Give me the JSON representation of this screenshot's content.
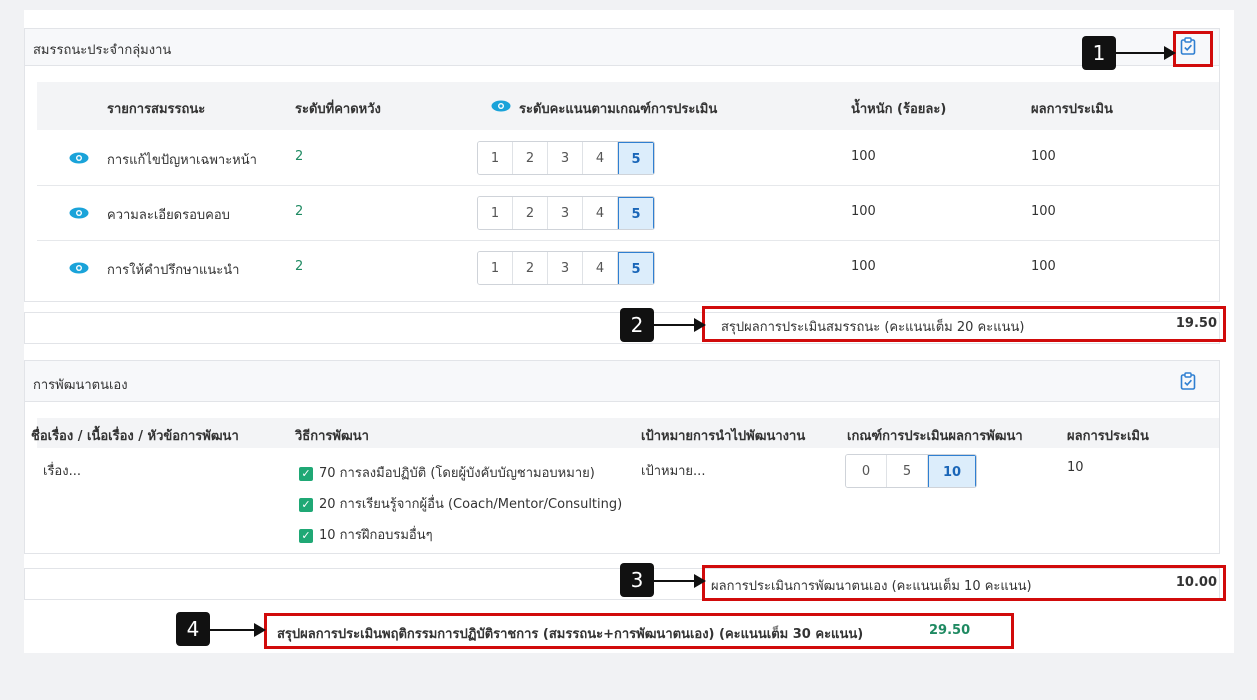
{
  "competency": {
    "title": "สมรรถนะประจำกลุ่มงาน",
    "headers": [
      "รายการสมรรถนะ",
      "ระดับที่คาดหวัง",
      "ระดับคะแนนตามเกณฑ์การประเมิน",
      "น้ำหนัก (ร้อยละ)",
      "ผลการประเมิน"
    ],
    "scale_options": [
      "1",
      "2",
      "3",
      "4",
      "5"
    ],
    "rows": [
      {
        "name": "การแก้ไขปัญหาเฉพาะหน้า",
        "expected": "2",
        "selected": "5",
        "weight": "100",
        "result": "100"
      },
      {
        "name": "ความละเอียดรอบคอบ",
        "expected": "2",
        "selected": "5",
        "weight": "100",
        "result": "100"
      },
      {
        "name": "การให้คำปรึกษาแนะนำ",
        "expected": "2",
        "selected": "5",
        "weight": "100",
        "result": "100"
      }
    ],
    "summary_label": "สรุปผลการประเมินสมรรถนะ (คะแนนเต็ม 20 คะแนน)",
    "summary_value": "19.50"
  },
  "self_dev": {
    "title": "การพัฒนาตนเอง",
    "headers": [
      "ชื่อเรื่อง / เนื้อเรื่อง / หัวข้อการพัฒนา",
      "วิธีการพัฒนา",
      "เป้าหมายการนำไปพัฒนางาน",
      "เกณฑ์การประเมินผลการพัฒนา",
      "ผลการประเมิน"
    ],
    "topic": "เรื่อง...",
    "methods": [
      "70 การลงมือปฏิบัติ (โดยผู้บังคับบัญชามอบหมาย)",
      "20 การเรียนรู้จากผู้อื่น (Coach/Mentor/Consulting)",
      "10 การฝึกอบรมอื่นๆ"
    ],
    "goal": "เป้าหมาย...",
    "criteria_options": [
      "0",
      "5",
      "10"
    ],
    "criteria_selected": "10",
    "result": "10",
    "summary_label": "ผลการประเมินการพัฒนาตนเอง (คะแนนเต็ม 10 คะแนน)",
    "summary_value": "10.00"
  },
  "total": {
    "label": "สรุปผลการประเมินพฤติกรรมการปฏิบัติราชการ (สมรรถนะ+การพัฒนาตนเอง) (คะแนนเต็ม 30 คะแนน)",
    "value": "29.50"
  },
  "callouts": [
    "1",
    "2",
    "3",
    "4"
  ],
  "icons": {
    "eye": "eye-icon",
    "clipboard": "clipboard-check-icon",
    "check": "checkbox-checked-icon"
  },
  "colors": {
    "accent_blue": "#2f7fd1",
    "green_value": "#1f8a62",
    "highlight_red": "#d10b0b",
    "eye_blue": "#1aa3d9"
  }
}
